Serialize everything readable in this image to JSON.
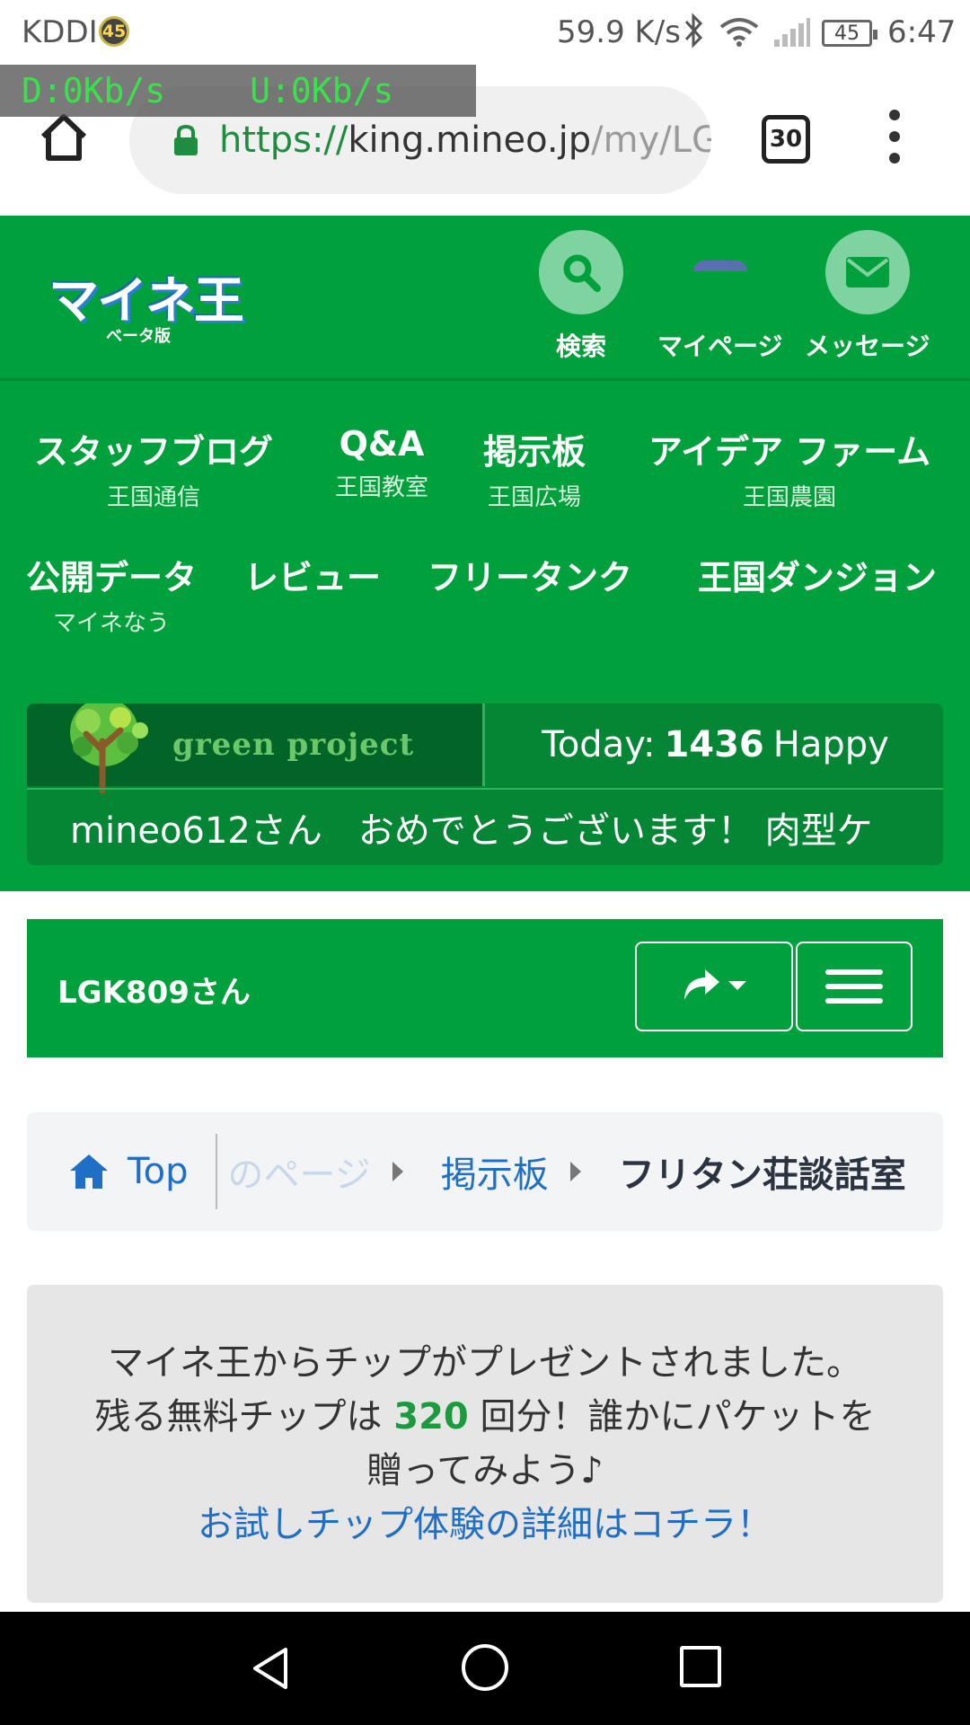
{
  "status_bar": {
    "carrier": "KDDI",
    "badge": "45",
    "speed": "59.9 K/s",
    "battery": "45",
    "time": "6:47"
  },
  "net_overlay": {
    "down": "D:0Kb/s",
    "up": "U:0Kb/s"
  },
  "browser": {
    "url_scheme": "https://",
    "url_host": "king.mineo.jp",
    "url_path": "/my/LG",
    "tab_count": "30",
    "icons": [
      "home-icon",
      "lock-icon",
      "tab-switcher-icon",
      "more-vert-icon"
    ]
  },
  "header": {
    "logo_text": "マイネ王",
    "logo_sub": "ベータ版",
    "buttons": [
      {
        "label": "検索",
        "icon": "search-icon"
      },
      {
        "label": "マイページ",
        "icon": "mypage-avatar-icon"
      },
      {
        "label": "メッセージ",
        "icon": "envelope-icon"
      }
    ]
  },
  "nav": {
    "items": [
      {
        "main": "スタッフブログ",
        "sub": "王国通信"
      },
      {
        "main": "Q&A",
        "sub": "王国教室"
      },
      {
        "main": "掲示板",
        "sub": "王国広場"
      },
      {
        "main": "アイデア ファーム",
        "sub": "王国農園"
      },
      {
        "main": "公開データ",
        "sub": "マイネなう"
      },
      {
        "main": "レビュー",
        "sub": ""
      },
      {
        "main": "フリータンク",
        "sub": ""
      },
      {
        "main": "王国ダンジョン",
        "sub": ""
      }
    ]
  },
  "green_project": {
    "title": "green project",
    "today_label": "Today:",
    "today_count": "1436",
    "today_suffix": "Happy",
    "message": "mineo612さん　おめでとうございます！ 肉型ケ"
  },
  "user_bar": {
    "username": "LGK809さん",
    "icons": [
      "share-icon",
      "caret-down-icon",
      "hamburger-icon"
    ]
  },
  "breadcrumb": {
    "home": "Top",
    "faded": "のページ",
    "crumb1": "掲示板",
    "current": "フリタン荘談話室"
  },
  "tip_box": {
    "line1": "マイネ王からチップがプレゼントされました。",
    "line2_pre": "残る無料チップは ",
    "line2_num": "320",
    "line2_post": " 回分！誰かにパケットを",
    "line3": "贈ってみよう♪",
    "link": "お試しチップ体験の詳細はコチラ！"
  },
  "colors": {
    "brand_green": "#00a03c",
    "dark_green": "#036428",
    "link_blue": "#1f6fc6"
  }
}
